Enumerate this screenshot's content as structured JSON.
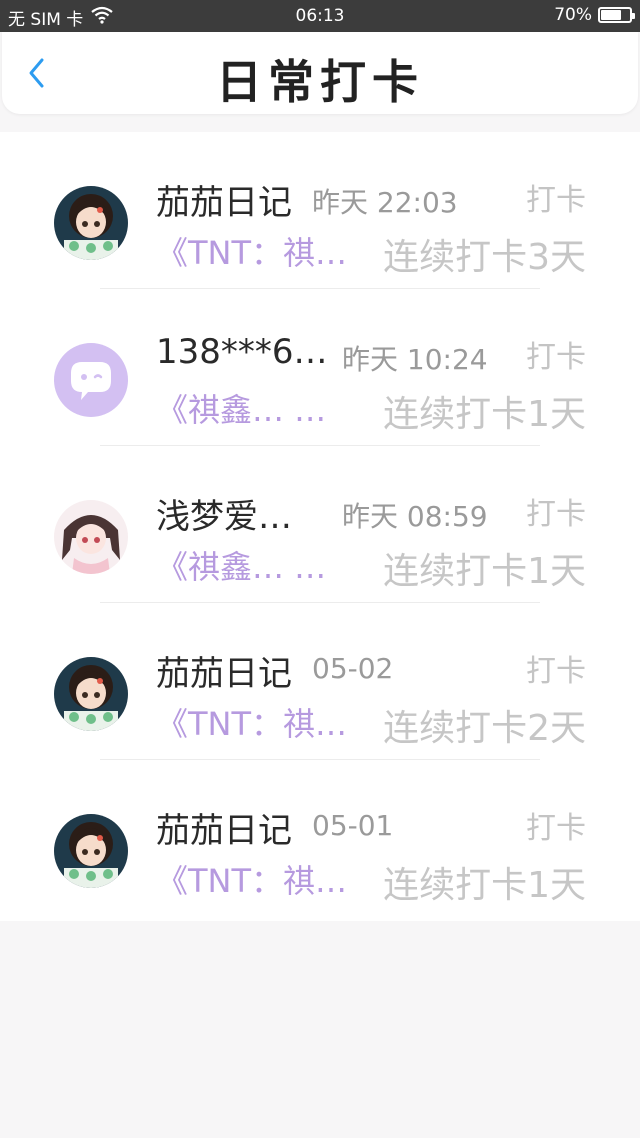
{
  "status_bar": {
    "carrier": "无 SIM 卡",
    "time": "06:13",
    "battery_text": "70%",
    "battery_level": 0.7
  },
  "nav": {
    "title": "日常打卡"
  },
  "entries": [
    {
      "username": "茄茄日记",
      "timestamp": "昨天 22:03",
      "tag": "打卡",
      "group": "《TNT：祺…",
      "streak": "连续打卡3天",
      "avatar": "anime-girl"
    },
    {
      "username": "138***6…",
      "timestamp": "昨天 10:24",
      "tag": "打卡",
      "group": "《祺鑫… …",
      "streak": "连续打卡1天",
      "avatar": "default-chat"
    },
    {
      "username": "浅梦爱…",
      "timestamp": "昨天 08:59",
      "tag": "打卡",
      "group": "《祺鑫… …",
      "streak": "连续打卡1天",
      "avatar": "anime-girl-pink"
    },
    {
      "username": "茄茄日记",
      "timestamp": "05-02",
      "tag": "打卡",
      "group": "《TNT：祺…",
      "streak": "连续打卡2天",
      "avatar": "anime-girl"
    },
    {
      "username": "茄茄日记",
      "timestamp": "05-01",
      "tag": "打卡",
      "group": "《TNT：祺…",
      "streak": "连续打卡1天",
      "avatar": "anime-girl"
    }
  ],
  "colors": {
    "accent_blue": "#2d9cf0",
    "group_purple": "#b69adf",
    "avatar_lilac": "#d3c0f2"
  }
}
